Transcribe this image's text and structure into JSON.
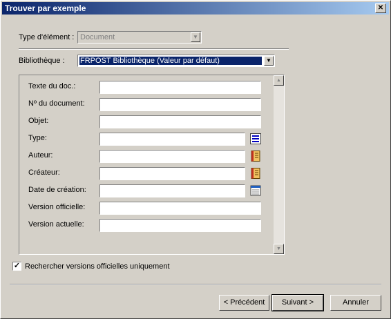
{
  "window": {
    "title": "Trouver par exemple",
    "close_glyph": "✕"
  },
  "element_type": {
    "label": "Type d'élément :",
    "value": "Document"
  },
  "library": {
    "label": "Bibliothèque :",
    "value": "FRPOST Bibliothèque  (Valeur par défaut)"
  },
  "fields": [
    {
      "label": "Texte du doc.:",
      "value": ""
    },
    {
      "label": "Nº du document:",
      "value": ""
    },
    {
      "label": "Objet:",
      "value": ""
    },
    {
      "label": "Type:",
      "value": ""
    },
    {
      "label": "Auteur:",
      "value": ""
    },
    {
      "label": "Créateur:",
      "value": ""
    },
    {
      "label": "Date de création:",
      "value": ""
    },
    {
      "label": "Version officielle:",
      "value": ""
    },
    {
      "label": "Version actuelle:",
      "value": ""
    }
  ],
  "official_only": {
    "label": "Rechercher versions officielles uniquement",
    "checked": true,
    "mark": "✓"
  },
  "buttons": {
    "previous": "< Précédent",
    "next": "Suivant >",
    "cancel": "Annuler"
  },
  "icons": {
    "type_lookup": "list-icon",
    "author_lookup": "book-icon",
    "creator_lookup": "book-icon",
    "date_lookup": "calendar-icon"
  },
  "colors": {
    "title_active": "#0a246a",
    "selection": "#0a246a",
    "face": "#d4d0c8"
  }
}
